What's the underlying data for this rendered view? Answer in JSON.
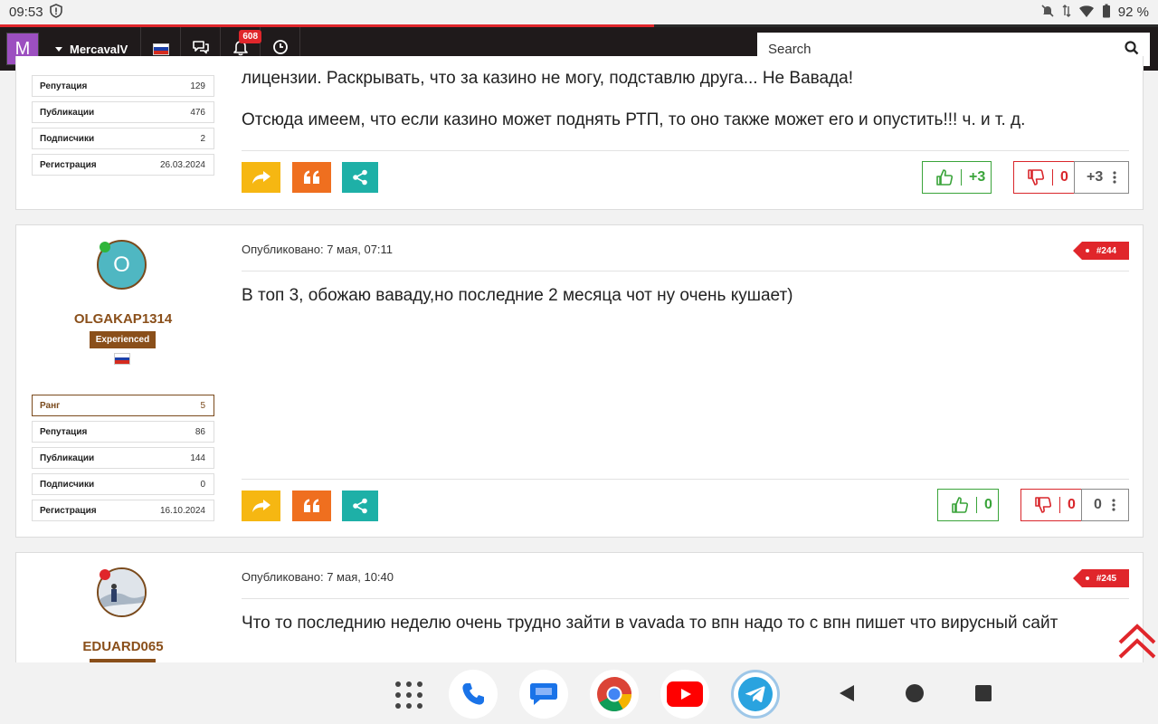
{
  "status_bar": {
    "time": "09:53",
    "battery": "92 %"
  },
  "progress": {
    "fraction": 0.565
  },
  "topnav": {
    "avatar_letter": "M",
    "username": "MercavalV",
    "notifications_count": "608",
    "search_placeholder": "Search"
  },
  "post_top": {
    "text_line1": "лицензии. Раскрывать, что за казино не могу, подставлю друга... Не Вавада!",
    "text_line2": "Отсюда имеем, что если казино может поднять РТП, то оно также может его и опустить!!! ч. и т. д.",
    "stats": [
      {
        "label": "Репутация",
        "value": "129"
      },
      {
        "label": "Публикации",
        "value": "476"
      },
      {
        "label": "Подписчики",
        "value": "2"
      },
      {
        "label": "Регистрация",
        "value": "26.03.2024"
      }
    ],
    "likes": "+3",
    "dislikes": "0",
    "total": "+3"
  },
  "post_244": {
    "meta": "Опубликовано: 7 мая, 07:11",
    "number": "#244",
    "avatar_letter": "O",
    "username": "OLGAKAP1314",
    "role": "Experienced",
    "text": "В топ 3, обожаю ваваду,но последние 2 месяца чот ну очень кушает)",
    "stats": [
      {
        "label": "Ранг",
        "value": "5"
      },
      {
        "label": "Репутация",
        "value": "86"
      },
      {
        "label": "Публикации",
        "value": "144"
      },
      {
        "label": "Подписчики",
        "value": "0"
      },
      {
        "label": "Регистрация",
        "value": "16.10.2024"
      }
    ],
    "likes": "0",
    "dislikes": "0",
    "total": "0"
  },
  "post_245": {
    "meta": "Опубликовано: 7 мая, 10:40",
    "number": "#245",
    "username": "EDUARD065",
    "text": "Что то последнию неделю очень трудно зайти в vavada то впн надо то с впн пишет что вирусный сайт"
  },
  "colors": {
    "accent_red": "#e0262b",
    "brand_brown": "#8a4f1a",
    "nav_bg": "#1f1a1b",
    "like_green": "#3aa43a",
    "teal": "#1eb0a7",
    "orange": "#ef6f1f",
    "yellow": "#f6b712"
  }
}
